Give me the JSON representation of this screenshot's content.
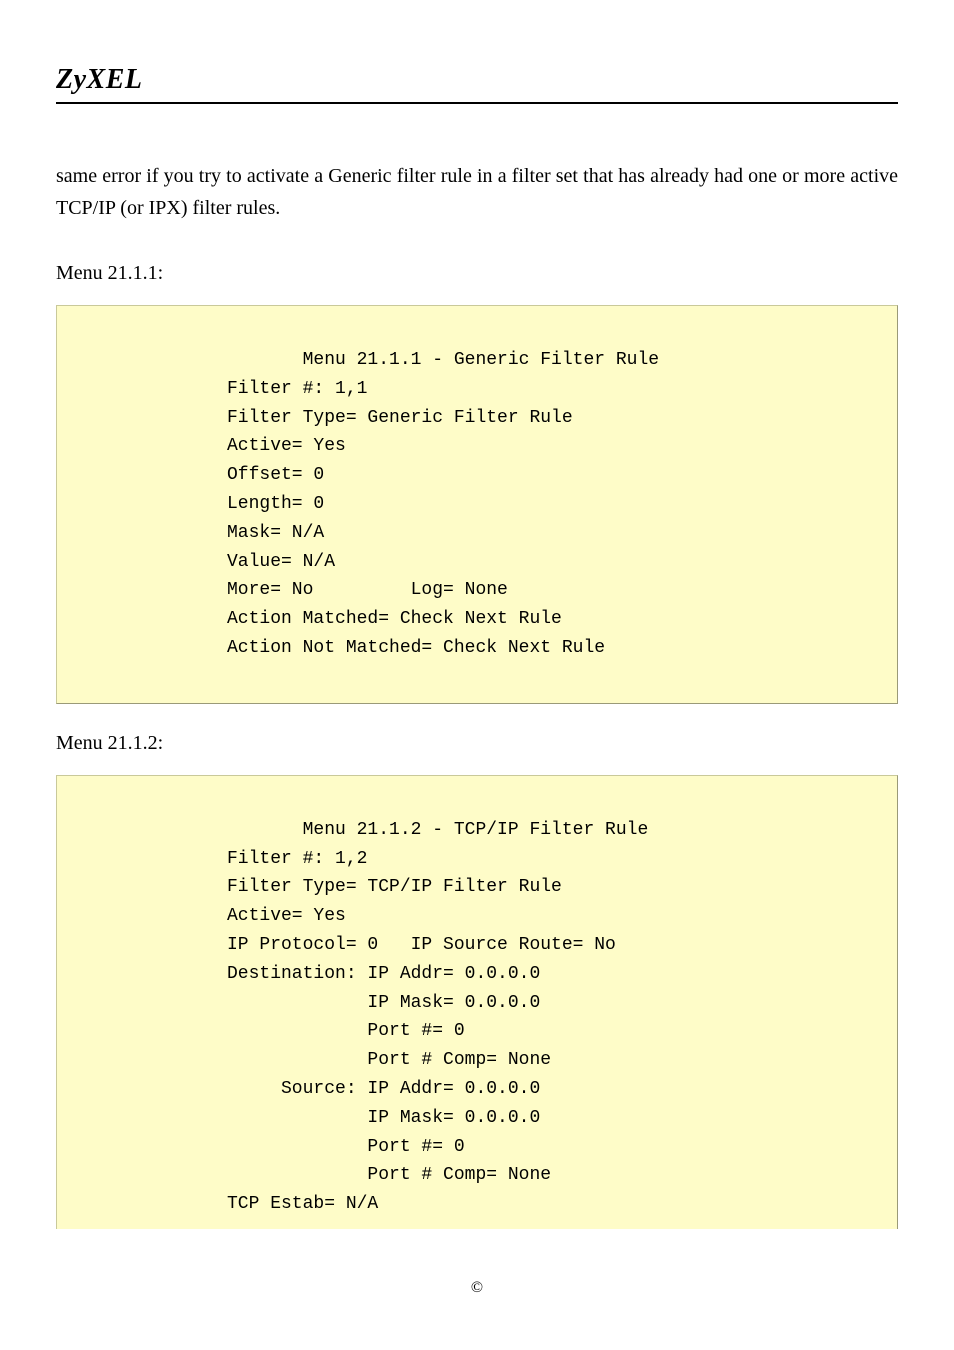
{
  "brand": "ZyXEL",
  "paragraph": "same error if you try to activate a Generic filter rule in a filter set that has already had one or more active TCP/IP (or IPX) filter rules.",
  "section1_label": "Menu 21.1.1:",
  "menu1_text": "       Menu 21.1.1 - Generic Filter Rule\nFilter #: 1,1\nFilter Type= Generic Filter Rule\nActive= Yes\nOffset= 0\nLength= 0\nMask= N/A\nValue= N/A\nMore= No         Log= None\nAction Matched= Check Next Rule\nAction Not Matched= Check Next Rule",
  "section2_label": "Menu 21.1.2:",
  "menu2_text": "       Menu 21.1.2 - TCP/IP Filter Rule\nFilter #: 1,2\nFilter Type= TCP/IP Filter Rule\nActive= Yes\nIP Protocol= 0   IP Source Route= No\nDestination: IP Addr= 0.0.0.0\n             IP Mask= 0.0.0.0\n             Port #= 0\n             Port # Comp= None\n     Source: IP Addr= 0.0.0.0\n             IP Mask= 0.0.0.0\n             Port #= 0\n             Port # Comp= None\nTCP Estab= N/A",
  "footer": "©"
}
